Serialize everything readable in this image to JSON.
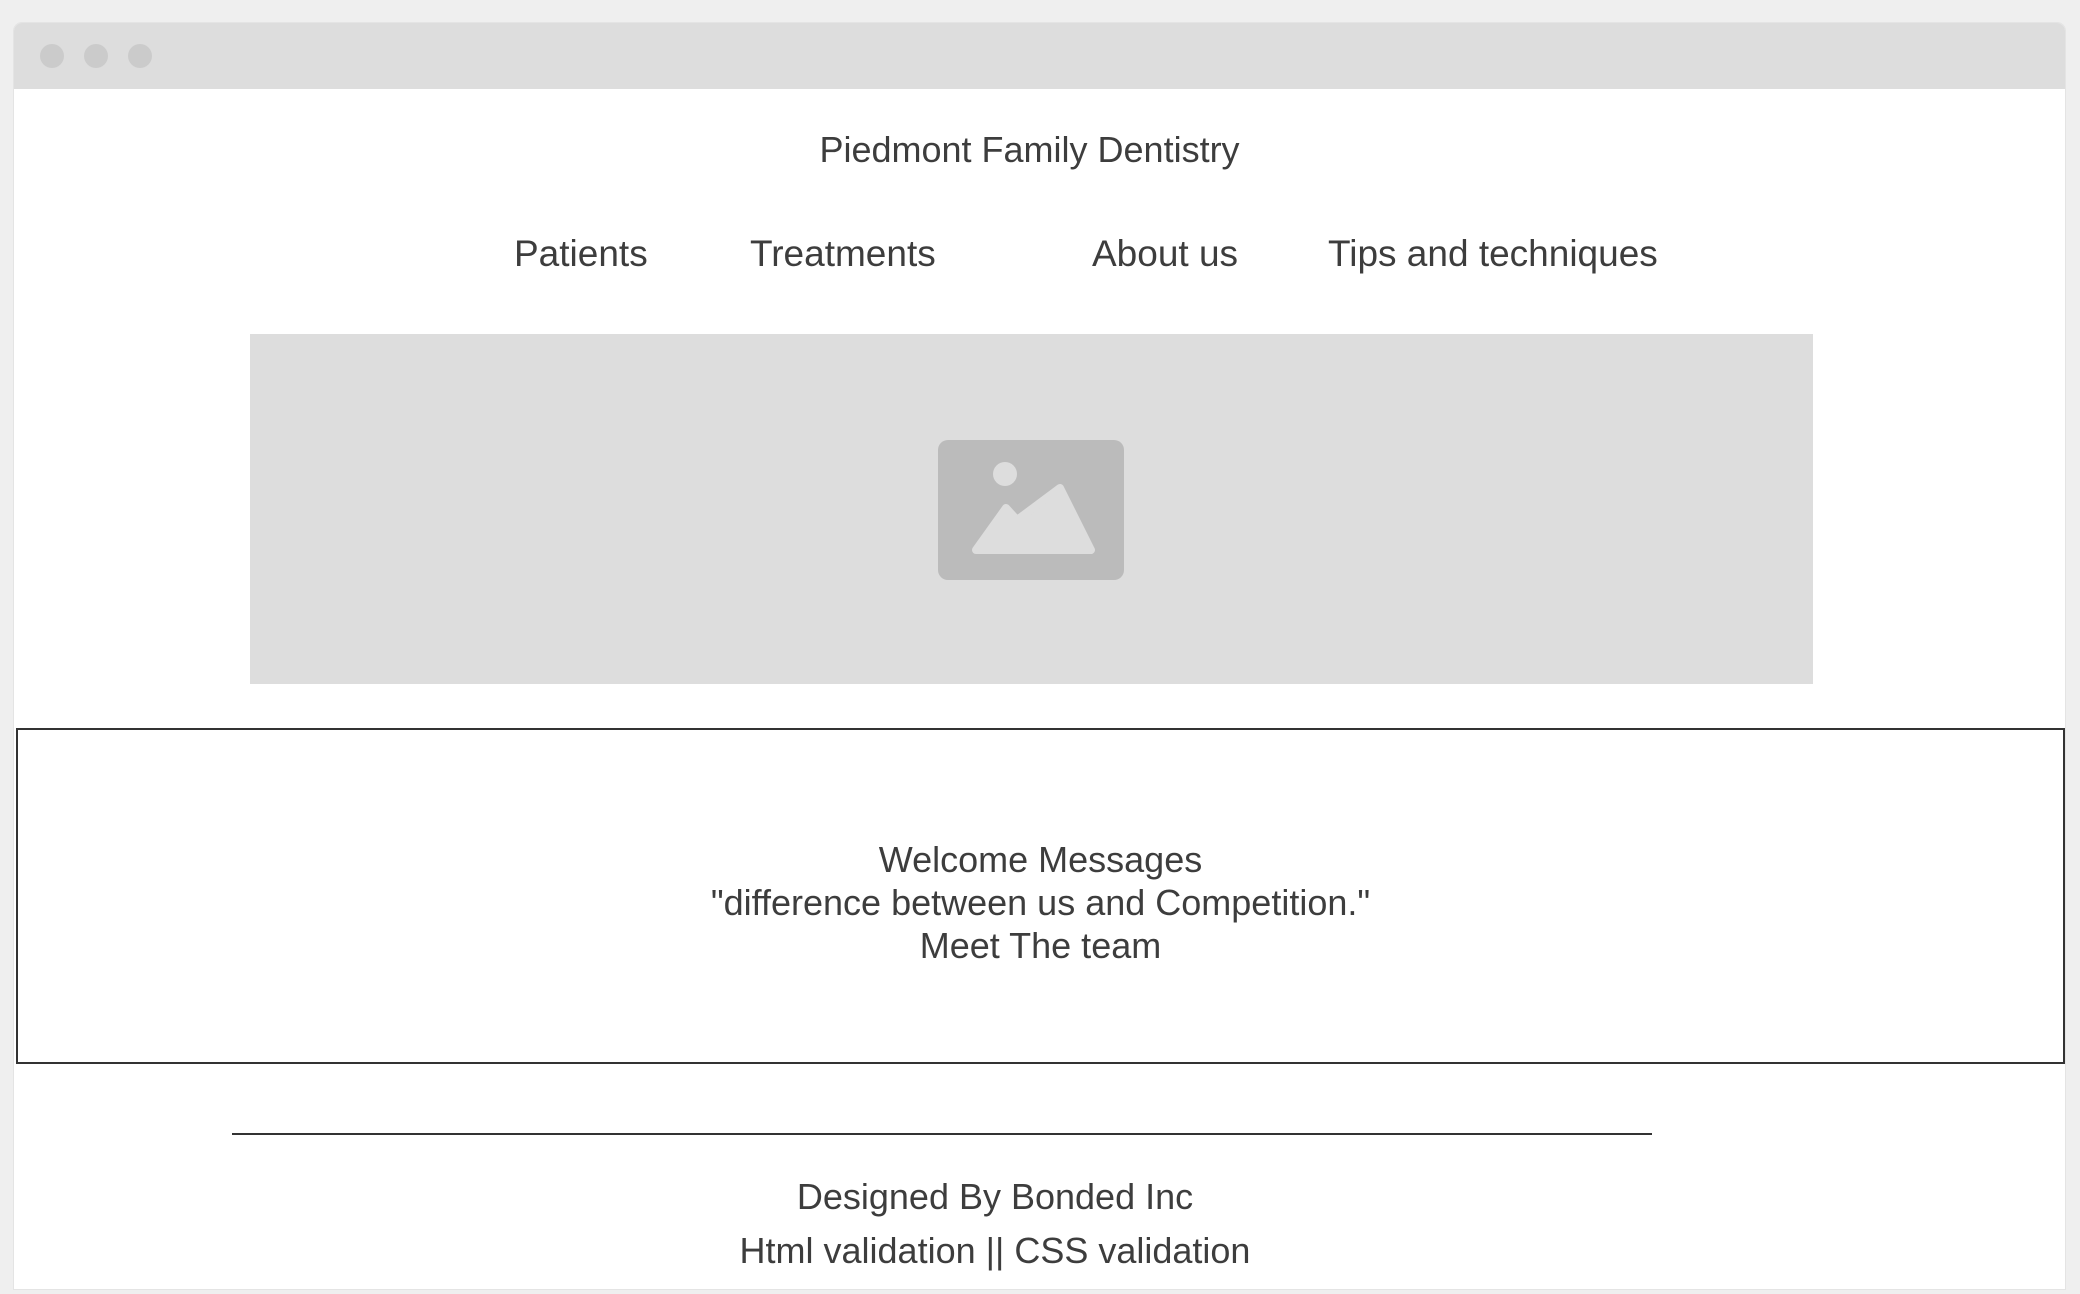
{
  "window": {
    "controls": [
      "close-dot",
      "minimize-dot",
      "maximize-dot"
    ]
  },
  "header": {
    "title": "Piedmont Family Dentistry"
  },
  "nav": {
    "items": [
      {
        "label": "Patients"
      },
      {
        "label": "Treatments"
      },
      {
        "label": "About us"
      },
      {
        "label": "Tips and techniques"
      }
    ]
  },
  "hero": {
    "icon": "image-placeholder-icon"
  },
  "welcome": {
    "lines": [
      "Welcome Messages",
      "\"difference between us and Competition.\"",
      "Meet The team"
    ]
  },
  "footer": {
    "credit": "Designed By Bonded Inc",
    "validation": "Html validation || CSS validation"
  },
  "colors": {
    "background": "#efefef",
    "titlebar": "#dddddd",
    "placeholder": "#dddddd",
    "placeholder_icon": "#bbbbbb",
    "text": "#3d3d3d",
    "border": "#333333"
  }
}
